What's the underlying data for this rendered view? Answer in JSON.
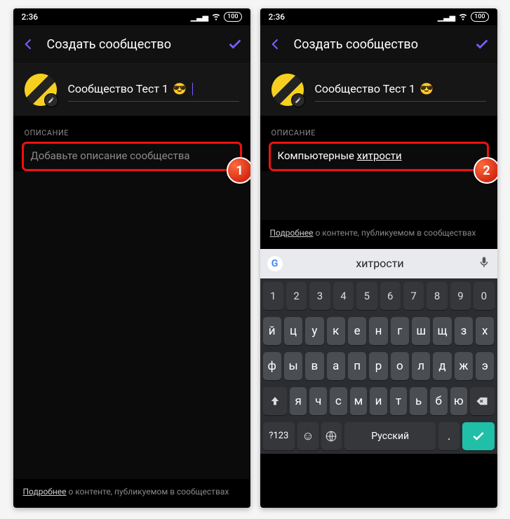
{
  "status": {
    "time": "2:36",
    "battery": "100"
  },
  "appbar": {
    "title": "Создать сообщество"
  },
  "community": {
    "name": "Сообщество Тест 1",
    "emoji": "😎"
  },
  "section": {
    "description_label": "ОПИСАНИЕ"
  },
  "left": {
    "desc_placeholder": "Добавьте описание сообщества",
    "badge": "1"
  },
  "right": {
    "desc_value_a": "Компьютерные ",
    "desc_value_b": "хитрости",
    "badge": "2"
  },
  "footer": {
    "link": "Подробнее",
    "rest": " о контенте, публикуемом в сообществах"
  },
  "keyboard": {
    "suggestion": "хитрости",
    "row_num": [
      "1",
      "2",
      "3",
      "4",
      "5",
      "6",
      "7",
      "8",
      "9",
      "0"
    ],
    "row1": [
      "й",
      "ц",
      "у",
      "к",
      "е",
      "н",
      "г",
      "ш",
      "щ",
      "з",
      "х"
    ],
    "row2": [
      "ф",
      "ы",
      "в",
      "а",
      "п",
      "р",
      "о",
      "л",
      "д",
      "ж",
      "э"
    ],
    "row3_mid": [
      "я",
      "ч",
      "с",
      "м",
      "и",
      "т",
      "ь",
      "б",
      "ю"
    ],
    "sym": "?123",
    "lang": "Русский",
    "dot": "."
  }
}
